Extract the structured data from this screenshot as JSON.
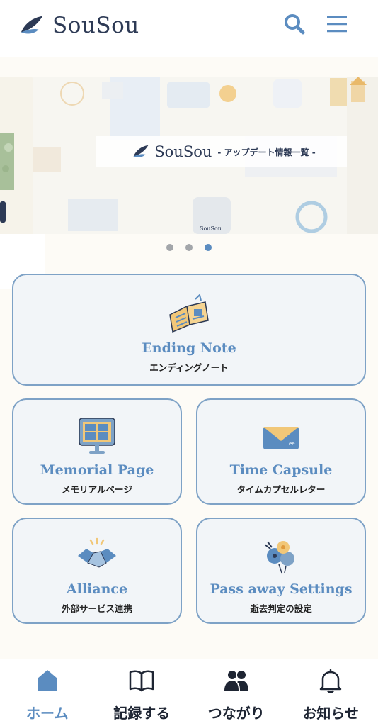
{
  "header": {
    "logo_text": "SouSou",
    "search_icon": "search-icon",
    "menu_icon": "hamburger-menu-icon"
  },
  "carousel": {
    "caption_logo": "SouSou",
    "caption_sub": "- アップデート情報一覧 -",
    "thumb_logo": "SouSou",
    "slide_count": 3,
    "active_index": 2
  },
  "cards": {
    "ending_note": {
      "title": "Ending Note",
      "sub": "エンディングノート",
      "icon": "ending-note-book-icon"
    },
    "memorial_page": {
      "title": "Memorial Page",
      "sub": "メモリアルページ",
      "icon": "memorial-monitor-icon"
    },
    "time_capsule": {
      "title": "Time Capsule",
      "sub": "タイムカプセルレター",
      "icon": "envelope-icon"
    },
    "alliance": {
      "title": "Alliance",
      "sub": "外部サービス連携",
      "icon": "handshake-icon"
    },
    "pass_away": {
      "title": "Pass away Settings",
      "sub": "逝去判定の設定",
      "icon": "flowers-icon"
    }
  },
  "bottom_nav": {
    "items": [
      {
        "label": "ホーム",
        "icon": "home-icon",
        "active": true
      },
      {
        "label": "記録する",
        "icon": "book-icon",
        "active": false
      },
      {
        "label": "つながり",
        "icon": "people-icon",
        "active": false
      },
      {
        "label": "お知らせ",
        "icon": "bell-icon",
        "active": false
      }
    ]
  },
  "colors": {
    "accent": "#5b8cc0",
    "logo": "#2d3a55",
    "card_bg": "#f2f5f8",
    "card_border": "#7ea2c6",
    "page_bg": "#fdfbf6"
  }
}
